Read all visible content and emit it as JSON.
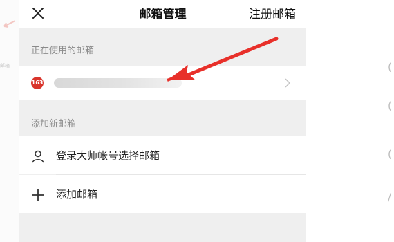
{
  "header": {
    "close_icon": "close-icon",
    "title": "邮箱管理",
    "register_label": "注册邮箱"
  },
  "current_section": {
    "label": "正在使用的邮箱",
    "account": {
      "provider_badge": "163",
      "address_obscured": true,
      "chevron_icon": "chevron-right-icon"
    }
  },
  "add_section": {
    "label": "添加新邮箱",
    "options": [
      {
        "icon": "user-icon",
        "label": "登录大师帐号选择邮箱"
      },
      {
        "icon": "plus-icon",
        "label": "添加邮箱"
      }
    ]
  },
  "annotation": {
    "arrow_color": "#e8302a"
  },
  "colors": {
    "panel_bg": "#efefef",
    "row_bg": "#ffffff",
    "badge_red": "#d9342b"
  }
}
